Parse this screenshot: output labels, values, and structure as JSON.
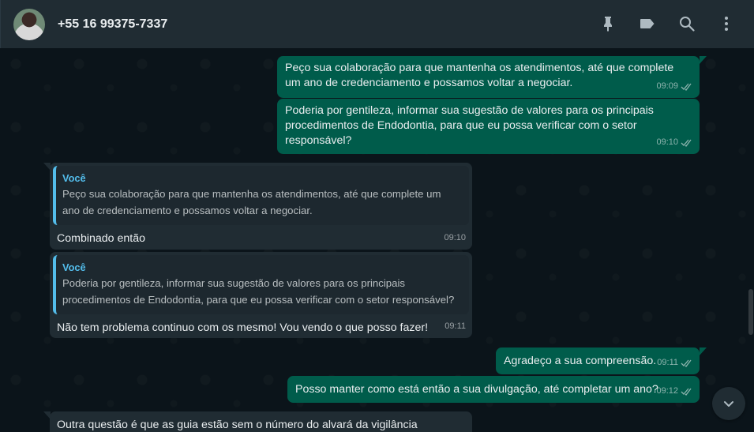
{
  "header": {
    "contact_name": "+55 16 99375-7337",
    "icons": [
      "pin-icon",
      "label-icon",
      "search-icon",
      "menu-icon"
    ]
  },
  "colors": {
    "outgoing_bubble": "#005c4b",
    "incoming_bubble": "#202c33",
    "quote_accent": "#53bdeb",
    "background": "#0b141a"
  },
  "messages": [
    {
      "direction": "out",
      "text": "Peço sua colaboração para que mantenha os atendimentos, até que complete um ano de credenciamento e possamos voltar a negociar.",
      "time": "09:09",
      "status": "read"
    },
    {
      "direction": "out",
      "text": "Poderia por gentileza, informar sua sugestão de valores para os principais procedimentos de Endodontia, para que eu possa verificar com o setor responsável?",
      "time": "09:10",
      "status": "read"
    },
    {
      "direction": "in",
      "quote_author": "Você",
      "quote_text": "Peço sua colaboração para que mantenha os atendimentos, até que complete um ano de credenciamento e possamos voltar a negociar.",
      "text": "Combinado então",
      "time": "09:10"
    },
    {
      "direction": "in",
      "quote_author": "Você",
      "quote_text": "Poderia por gentileza, informar sua sugestão de valores para os principais procedimentos de Endodontia, para que eu possa verificar com o setor responsável?",
      "text": "Não tem problema continuo com os mesmo! Vou vendo o que posso fazer!",
      "time": "09:11"
    },
    {
      "direction": "out",
      "text": "Agradeço a sua compreensão.",
      "time": "09:11",
      "status": "read"
    },
    {
      "direction": "out",
      "text": "Posso manter como está então a sua divulgação, até completar um ano?",
      "time": "09:12",
      "status": "read"
    },
    {
      "direction": "in",
      "text": "Outra questão é que as guia estão sem o número do alvará da vigilância sanitária,"
    }
  ]
}
